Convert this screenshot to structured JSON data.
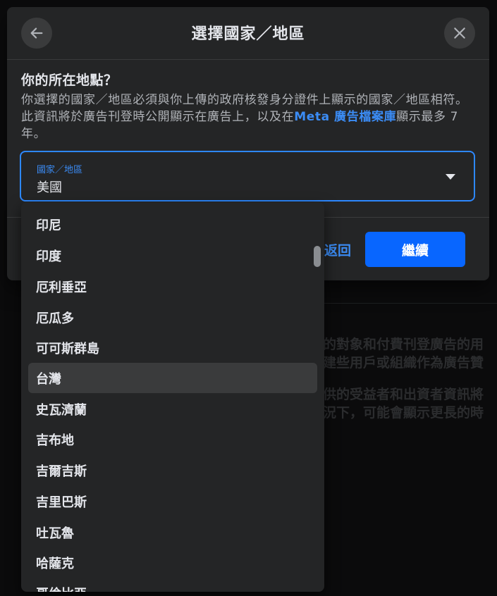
{
  "dialog": {
    "title": "選擇國家／地區",
    "question": "你的所在地點？",
    "desc_part1": "你選擇的國家／地區必須與你上傳的政府核發身分證件上顯示的國家／地區相符。此資訊將於廣告刊登時公開顯示在廣告上，以及在",
    "desc_link": "Meta 廣告檔案庫",
    "desc_part2": "顯示最多 7 年。",
    "select_label": "國家／地區",
    "select_value": "美國",
    "back_link": "返回",
    "continue_label": "繼續"
  },
  "dropdown": {
    "options": [
      "印尼",
      "印度",
      "厄利垂亞",
      "厄瓜多",
      "可可斯群島",
      "台灣",
      "史瓦濟蘭",
      "吉布地",
      "吉爾吉斯",
      "吉里巴斯",
      "吐瓦魯",
      "哈薩克",
      "哥倫比亞"
    ],
    "highlighted": "台灣"
  },
  "background": {
    "line1": "的對象和付費刊登廣告的用",
    "line2": "建些用戶或組織作為廣告贊",
    "line3": "供的受益者和出資者資訊將",
    "line4": "況下，可能會顯示更長的時"
  },
  "colors": {
    "accent": "#0866ff",
    "link": "#3b8cf5",
    "surface": "#242526"
  }
}
